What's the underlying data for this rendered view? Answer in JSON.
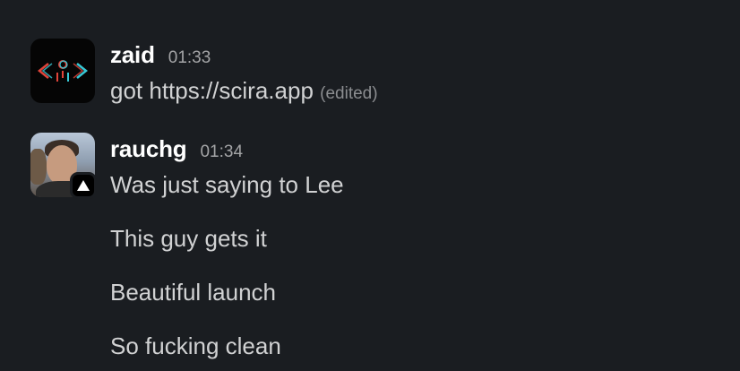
{
  "messages": [
    {
      "username": "zaid",
      "time": "01:33",
      "text": "got https://scira.app",
      "edited": "(edited)",
      "avatar_icon": "code-logo-icon"
    },
    {
      "username": "rauchg",
      "time": "01:34",
      "avatar_icon": "profile-photo",
      "badge_icon": "vercel-triangle-icon",
      "lines": [
        "Was just saying to Lee",
        "This guy gets it",
        "Beautiful launch",
        "So fucking clean"
      ]
    }
  ],
  "colors": {
    "background": "#1a1d21",
    "username": "#ffffff",
    "text": "#d1d2d3",
    "timestamp": "#a3a4a6",
    "logo_red": "#e0443a",
    "logo_cyan": "#38c9d6"
  }
}
